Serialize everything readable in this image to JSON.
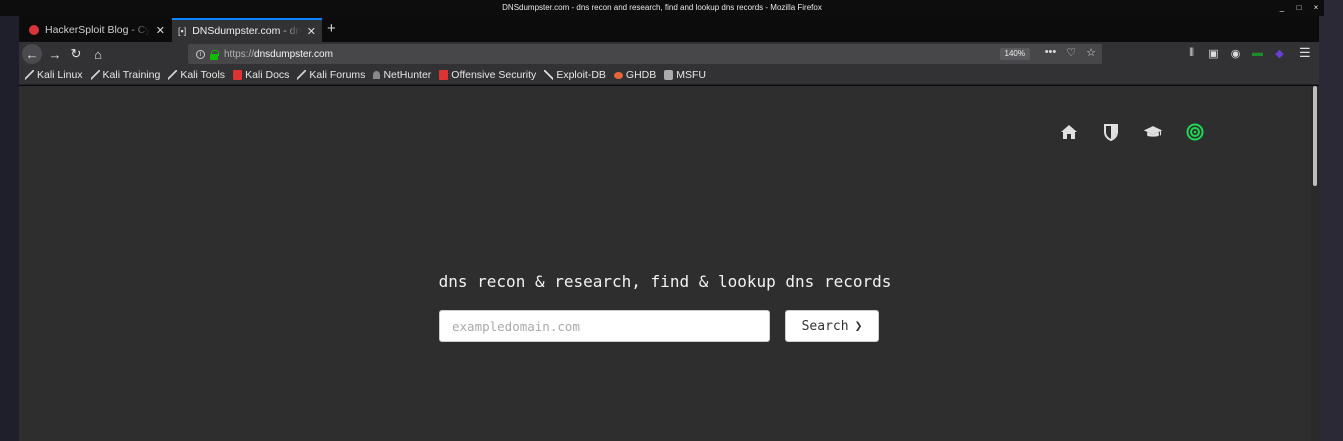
{
  "window": {
    "title": "DNSdumpster.com - dns recon and research, find and lookup dns records - Mozilla Firefox",
    "controls": [
      "_",
      "□",
      "×"
    ]
  },
  "tabs": [
    {
      "label": "HackerSploit Blog - Cybe",
      "active": false,
      "favicon_color": "#d9343b"
    },
    {
      "label": "DNSdumpster.com - dns",
      "active": true,
      "favicon_icon": "bracket-icon"
    }
  ],
  "navbar": {
    "url_proto": "https://",
    "url_host": "dnsdumpster.com",
    "zoom": "140%"
  },
  "bookmarks": [
    {
      "label": "Kali Linux",
      "icon": "kali"
    },
    {
      "label": "Kali Training",
      "icon": "kali"
    },
    {
      "label": "Kali Tools",
      "icon": "kali"
    },
    {
      "label": "Kali Docs",
      "icon": "red"
    },
    {
      "label": "Kali Forums",
      "icon": "kali"
    },
    {
      "label": "NetHunter",
      "icon": "dark"
    },
    {
      "label": "Offensive Security",
      "icon": "red"
    },
    {
      "label": "Exploit-DB",
      "icon": "exploit"
    },
    {
      "label": "GHDB",
      "icon": "orange"
    },
    {
      "label": "MSFU",
      "icon": "msfu"
    }
  ],
  "site": {
    "headline": "dns recon & research, find & lookup dns records",
    "search_placeholder": "exampledomain.com",
    "search_button": "Search",
    "nav_icons": [
      "home-icon",
      "shield-icon",
      "graduation-cap-icon",
      "target-icon"
    ],
    "accent_color": "#1fd655"
  }
}
